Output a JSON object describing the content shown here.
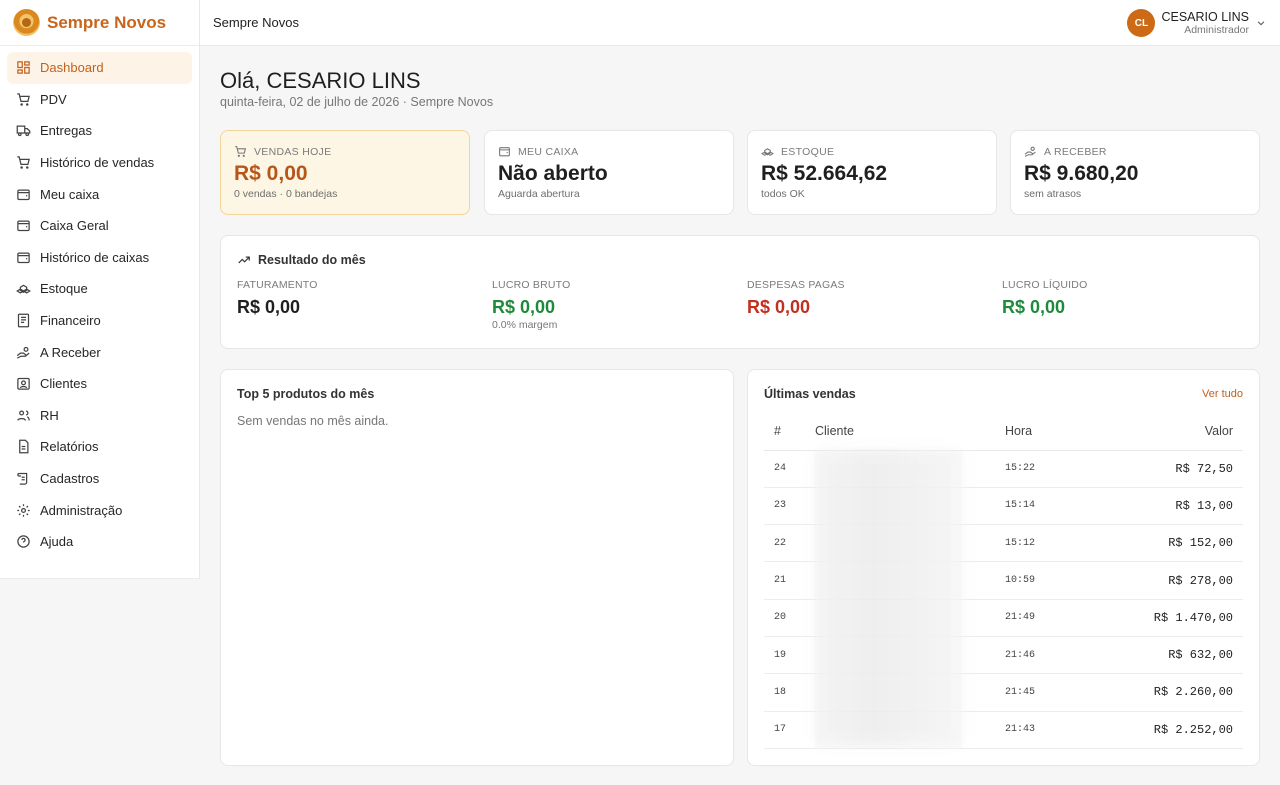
{
  "brand": {
    "name": "Sempre Novos"
  },
  "header": {
    "title": "Sempre Novos"
  },
  "user": {
    "initials": "CL",
    "name": "CESARIO LINS",
    "role": "Administrador"
  },
  "sidebar": {
    "items": [
      {
        "label": "Dashboard",
        "icon": "dashboard-icon"
      },
      {
        "label": "PDV",
        "icon": "cart-icon"
      },
      {
        "label": "Entregas",
        "icon": "truck-icon"
      },
      {
        "label": "Histórico de vendas",
        "icon": "cart-icon"
      },
      {
        "label": "Meu caixa",
        "icon": "wallet-icon"
      },
      {
        "label": "Caixa Geral",
        "icon": "wallet-icon"
      },
      {
        "label": "Histórico de caixas",
        "icon": "wallet-icon"
      },
      {
        "label": "Estoque",
        "icon": "boxes-icon"
      },
      {
        "label": "Financeiro",
        "icon": "receipt-icon"
      },
      {
        "label": "A Receber",
        "icon": "hand-coins-icon"
      },
      {
        "label": "Clientes",
        "icon": "contact-icon"
      },
      {
        "label": "RH",
        "icon": "users-icon"
      },
      {
        "label": "Relatórios",
        "icon": "report-icon"
      },
      {
        "label": "Cadastros",
        "icon": "scroll-icon"
      },
      {
        "label": "Administração",
        "icon": "gear-icon"
      },
      {
        "label": "Ajuda",
        "icon": "help-icon"
      }
    ]
  },
  "greeting": {
    "title": "Olá, CESARIO LINS",
    "subtitle": "quinta-feira, 02 de julho de 2026 · Sempre Novos"
  },
  "kpis": [
    {
      "label": "VENDAS HOJE",
      "value": "R$ 0,00",
      "sub": "0 vendas · 0 bandejas",
      "icon": "cart-icon"
    },
    {
      "label": "MEU CAIXA",
      "value": "Não aberto",
      "sub": "Aguarda abertura",
      "icon": "wallet-icon"
    },
    {
      "label": "ESTOQUE",
      "value": "R$ 52.664,62",
      "sub": "todos OK",
      "icon": "boxes-icon"
    },
    {
      "label": "A RECEBER",
      "value": "R$ 9.680,20",
      "sub": "sem atrasos",
      "icon": "hand-coins-icon"
    }
  ],
  "results": {
    "title": "Resultado do mês",
    "items": [
      {
        "label": "FATURAMENTO",
        "value": "R$ 0,00",
        "sub": ""
      },
      {
        "label": "LUCRO BRUTO",
        "value": "R$ 0,00",
        "sub": "0.0% margem"
      },
      {
        "label": "DESPESAS PAGAS",
        "value": "R$ 0,00",
        "sub": ""
      },
      {
        "label": "LUCRO LÍQUIDO",
        "value": "R$ 0,00",
        "sub": ""
      }
    ],
    "colors": {
      "green": "#1f8a3c",
      "red": "#c2301f"
    }
  },
  "top_products": {
    "title": "Top 5 produtos do mês",
    "empty": "Sem vendas no mês ainda."
  },
  "recent_sales": {
    "title": "Últimas vendas",
    "see_all": "Ver tudo",
    "columns": [
      "#",
      "Cliente",
      "Hora",
      "Valor"
    ],
    "rows": [
      {
        "num": "24",
        "cliente": "",
        "hora": "15:22",
        "valor": "R$ 72,50"
      },
      {
        "num": "23",
        "cliente": "",
        "hora": "15:14",
        "valor": "R$ 13,00"
      },
      {
        "num": "22",
        "cliente": "",
        "hora": "15:12",
        "valor": "R$ 152,00"
      },
      {
        "num": "21",
        "cliente": "",
        "hora": "10:59",
        "valor": "R$ 278,00"
      },
      {
        "num": "20",
        "cliente": "",
        "hora": "21:49",
        "valor": "R$ 1.470,00"
      },
      {
        "num": "19",
        "cliente": "",
        "hora": "21:46",
        "valor": "R$ 632,00"
      },
      {
        "num": "18",
        "cliente": "",
        "hora": "21:45",
        "valor": "R$ 2.260,00"
      },
      {
        "num": "17",
        "cliente": "",
        "hora": "21:43",
        "valor": "R$ 2.252,00"
      }
    ]
  },
  "accent": "#c4601b"
}
